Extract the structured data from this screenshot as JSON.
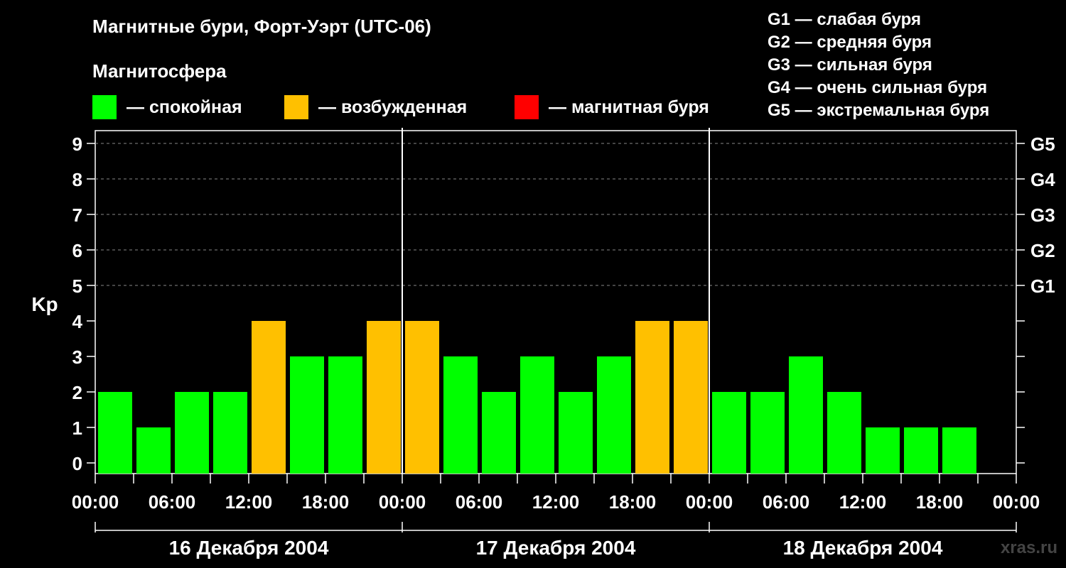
{
  "header": {
    "title": "Магнитные бури, Форт-Уэрт (UTC-06)",
    "subtitle": "Магнитосфера"
  },
  "legend": [
    {
      "label": "— спокойная",
      "color": "#00ff00"
    },
    {
      "label": "— возбужденная",
      "color": "#ffc000"
    },
    {
      "label": "— магнитная буря",
      "color": "#ff0000"
    }
  ],
  "storm_levels": [
    "G1 — слабая буря",
    "G2 — средняя буря",
    "G3 — сильная буря",
    "G4 — очень сильная буря",
    "G5 — экстремальная буря"
  ],
  "watermark": "xras.ru",
  "chart_data": {
    "type": "bar",
    "ylabel": "Kp",
    "ylim": [
      0,
      9
    ],
    "yticks": [
      0,
      1,
      2,
      3,
      4,
      5,
      6,
      7,
      8,
      9
    ],
    "right_labels": [
      {
        "value": 5,
        "label": "G1"
      },
      {
        "value": 6,
        "label": "G2"
      },
      {
        "value": 7,
        "label": "G3"
      },
      {
        "value": 8,
        "label": "G4"
      },
      {
        "value": 9,
        "label": "G5"
      }
    ],
    "grid": "dashed horizontal",
    "x_tick_labels": [
      "00:00",
      "06:00",
      "12:00",
      "18:00",
      "00:00",
      "06:00",
      "12:00",
      "18:00",
      "00:00",
      "06:00",
      "12:00",
      "18:00",
      "00:00"
    ],
    "days": [
      "16 Декабря 2004",
      "17 Декабря 2004",
      "18 Декабря 2004"
    ],
    "interval_hours": 3,
    "values": [
      2,
      1,
      2,
      2,
      4,
      3,
      3,
      4,
      4,
      3,
      2,
      3,
      2,
      3,
      4,
      4,
      2,
      2,
      3,
      2,
      1,
      1,
      1
    ],
    "colors": {
      "quiet": "#00ff00",
      "active": "#ffc000",
      "storm": "#ff0000"
    }
  }
}
